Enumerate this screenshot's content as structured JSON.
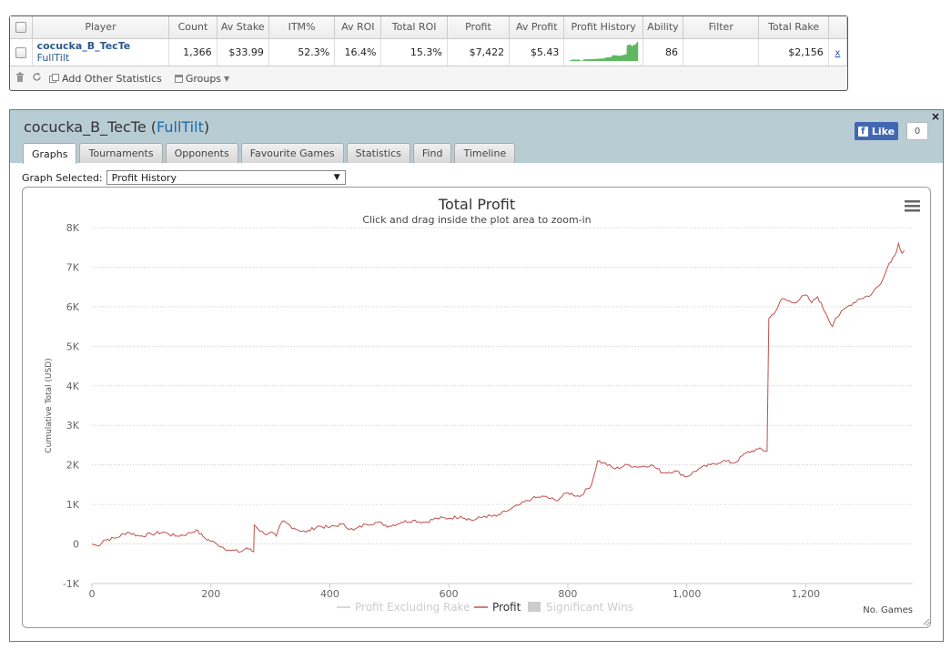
{
  "table": {
    "headers": [
      "Player",
      "Count",
      "Av Stake",
      "ITM%",
      "Av ROI",
      "Total ROI",
      "Profit",
      "Av Profit",
      "Profit History",
      "Ability",
      "Filter",
      "Total Rake"
    ],
    "row": {
      "player": "cocucka_B_TecTe",
      "site": "FullTilt",
      "count": "1,366",
      "av_stake": "$33.99",
      "itm": "52.3%",
      "av_roi": "16.4%",
      "total_roi": "15.3%",
      "profit": "$7,422",
      "av_profit": "$5.43",
      "ability": "86",
      "filter": "",
      "total_rake": "$2,156",
      "remove": "x"
    },
    "sparkline_color": "#5fb85f"
  },
  "toolbar": {
    "delete_icon": "trash-icon",
    "refresh_icon": "refresh-icon",
    "add_stats_label": "Add Other Statistics",
    "groups_label": "Groups"
  },
  "window": {
    "player": "cocucka_B_TecTe",
    "open_paren": "(",
    "site": "FullTilt",
    "close_paren": ")",
    "close_label": "×",
    "like_label": "Like",
    "like_count": "0",
    "tabs": [
      "Graphs",
      "Tournaments",
      "Opponents",
      "Favourite Games",
      "Statistics",
      "Find",
      "Timeline"
    ],
    "active_tab": "Graphs",
    "graph_selected_label": "Graph Selected:",
    "graph_selected_value": "Profit History",
    "graph_dropdown_arrow": "▼"
  },
  "chart_data": {
    "type": "line",
    "title": "Total Profit",
    "subtitle": "Click and drag inside the plot area to zoom-in",
    "xlabel": "No. Games",
    "ylabel": "Cumulative Total (USD)",
    "xlim": [
      0,
      1380
    ],
    "ylim": [
      -1000,
      8000
    ],
    "x_ticks": [
      "0",
      "200",
      "400",
      "600",
      "800",
      "1,000",
      "1,200"
    ],
    "x_tick_values": [
      0,
      200,
      400,
      600,
      800,
      1000,
      1200
    ],
    "y_ticks": [
      "-1K",
      "0",
      "1K",
      "2K",
      "3K",
      "4K",
      "5K",
      "6K",
      "7K",
      "8K"
    ],
    "y_tick_values": [
      -1000,
      0,
      1000,
      2000,
      3000,
      4000,
      5000,
      6000,
      7000,
      8000
    ],
    "grid": true,
    "legend_position": "bottom",
    "legend": [
      "Profit Excluding Rake",
      "Profit",
      "Significant Wins"
    ],
    "colors": {
      "profit": "#c0504d",
      "profit_ex_rake": "#cccccc",
      "significant_wins": "#cccccc",
      "axis_text": "#666666"
    },
    "series": [
      {
        "name": "Profit",
        "points": [
          [
            0,
            0
          ],
          [
            10,
            -50
          ],
          [
            20,
            100
          ],
          [
            40,
            150
          ],
          [
            60,
            300
          ],
          [
            80,
            200
          ],
          [
            100,
            250
          ],
          [
            120,
            300
          ],
          [
            140,
            200
          ],
          [
            160,
            250
          ],
          [
            175,
            350
          ],
          [
            190,
            150
          ],
          [
            210,
            0
          ],
          [
            230,
            -150
          ],
          [
            250,
            -200
          ],
          [
            260,
            -100
          ],
          [
            272,
            -200
          ],
          [
            273,
            480
          ],
          [
            290,
            250
          ],
          [
            300,
            300
          ],
          [
            310,
            200
          ],
          [
            320,
            580
          ],
          [
            340,
            400
          ],
          [
            360,
            300
          ],
          [
            380,
            450
          ],
          [
            400,
            420
          ],
          [
            420,
            500
          ],
          [
            440,
            350
          ],
          [
            460,
            500
          ],
          [
            480,
            550
          ],
          [
            500,
            450
          ],
          [
            520,
            550
          ],
          [
            540,
            600
          ],
          [
            560,
            550
          ],
          [
            580,
            650
          ],
          [
            600,
            650
          ],
          [
            620,
            700
          ],
          [
            640,
            600
          ],
          [
            660,
            700
          ],
          [
            680,
            700
          ],
          [
            700,
            850
          ],
          [
            720,
            1000
          ],
          [
            740,
            1150
          ],
          [
            760,
            1200
          ],
          [
            780,
            1100
          ],
          [
            800,
            1300
          ],
          [
            820,
            1200
          ],
          [
            840,
            1500
          ],
          [
            850,
            2100
          ],
          [
            860,
            2050
          ],
          [
            880,
            1900
          ],
          [
            900,
            2000
          ],
          [
            920,
            1950
          ],
          [
            940,
            2000
          ],
          [
            960,
            1800
          ],
          [
            980,
            1850
          ],
          [
            1000,
            1700
          ],
          [
            1020,
            1900
          ],
          [
            1040,
            2000
          ],
          [
            1060,
            2100
          ],
          [
            1080,
            2050
          ],
          [
            1100,
            2300
          ],
          [
            1120,
            2400
          ],
          [
            1135,
            2350
          ],
          [
            1138,
            5700
          ],
          [
            1150,
            5900
          ],
          [
            1160,
            6200
          ],
          [
            1180,
            6100
          ],
          [
            1200,
            6300
          ],
          [
            1210,
            6100
          ],
          [
            1220,
            6250
          ],
          [
            1235,
            5800
          ],
          [
            1245,
            5500
          ],
          [
            1250,
            5700
          ],
          [
            1270,
            6000
          ],
          [
            1290,
            6200
          ],
          [
            1310,
            6300
          ],
          [
            1330,
            6700
          ],
          [
            1340,
            7100
          ],
          [
            1350,
            7300
          ],
          [
            1356,
            7600
          ],
          [
            1362,
            7350
          ],
          [
            1366,
            7422
          ]
        ]
      }
    ]
  }
}
